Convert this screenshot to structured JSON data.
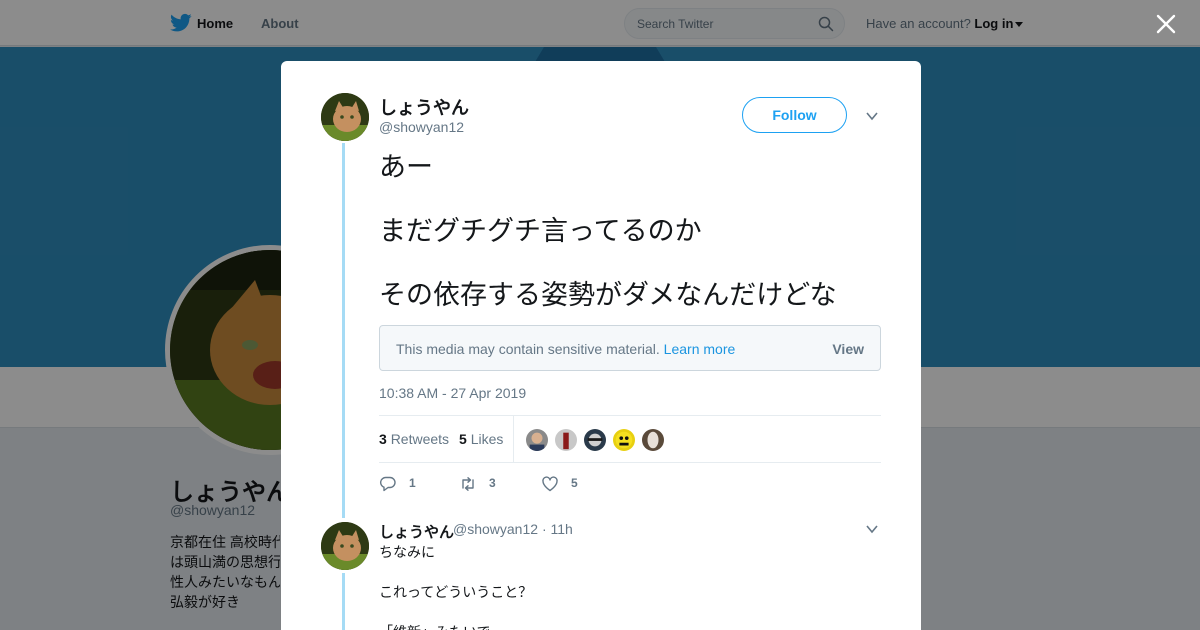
{
  "nav": {
    "home": "Home",
    "about": "About",
    "search_placeholder": "Search Twitter",
    "have_account": "Have an account?",
    "login": "Log in"
  },
  "profile": {
    "name": "しょうやん",
    "handle": "@showyan12",
    "bio_lines": [
      "京都在住 高校時代",
      "は頭山満の思想行",
      "性人みたいなもん",
      "弘毅が好き"
    ]
  },
  "tweet": {
    "name": "しょうやん",
    "handle": "@showyan12",
    "follow_label": "Follow",
    "text_lines": [
      "あー",
      "まだグチグチ言ってるのか",
      "その依存する姿勢がダメなんだけどな"
    ],
    "sensitive_message": "This media may contain sensitive material.",
    "learn_more": "Learn more",
    "view_label": "View",
    "timestamp": "10:38 AM - 27 Apr 2019",
    "retweets_count": "3",
    "retweets_label": "Retweets",
    "likes_count": "5",
    "likes_label": "Likes",
    "replies": "1",
    "retweets_action": "3",
    "likes_action": "5"
  },
  "reply": {
    "name": "しょうやん",
    "handle": "@showyan12",
    "time": "· 11h",
    "text_lines": [
      "ちなみに",
      "これってどういうこと？",
      "「維新」みたいで"
    ]
  },
  "colors": {
    "accent": "#1da1f2",
    "banner": "#2f8ec0",
    "thread_line": "#a5dbf5",
    "overlay": "rgba(0,0,0,0.45)"
  },
  "icons": [
    "twitter-bird-icon",
    "search-icon",
    "close-icon",
    "chevron-down-icon",
    "reply-icon",
    "retweet-icon",
    "heart-icon"
  ]
}
